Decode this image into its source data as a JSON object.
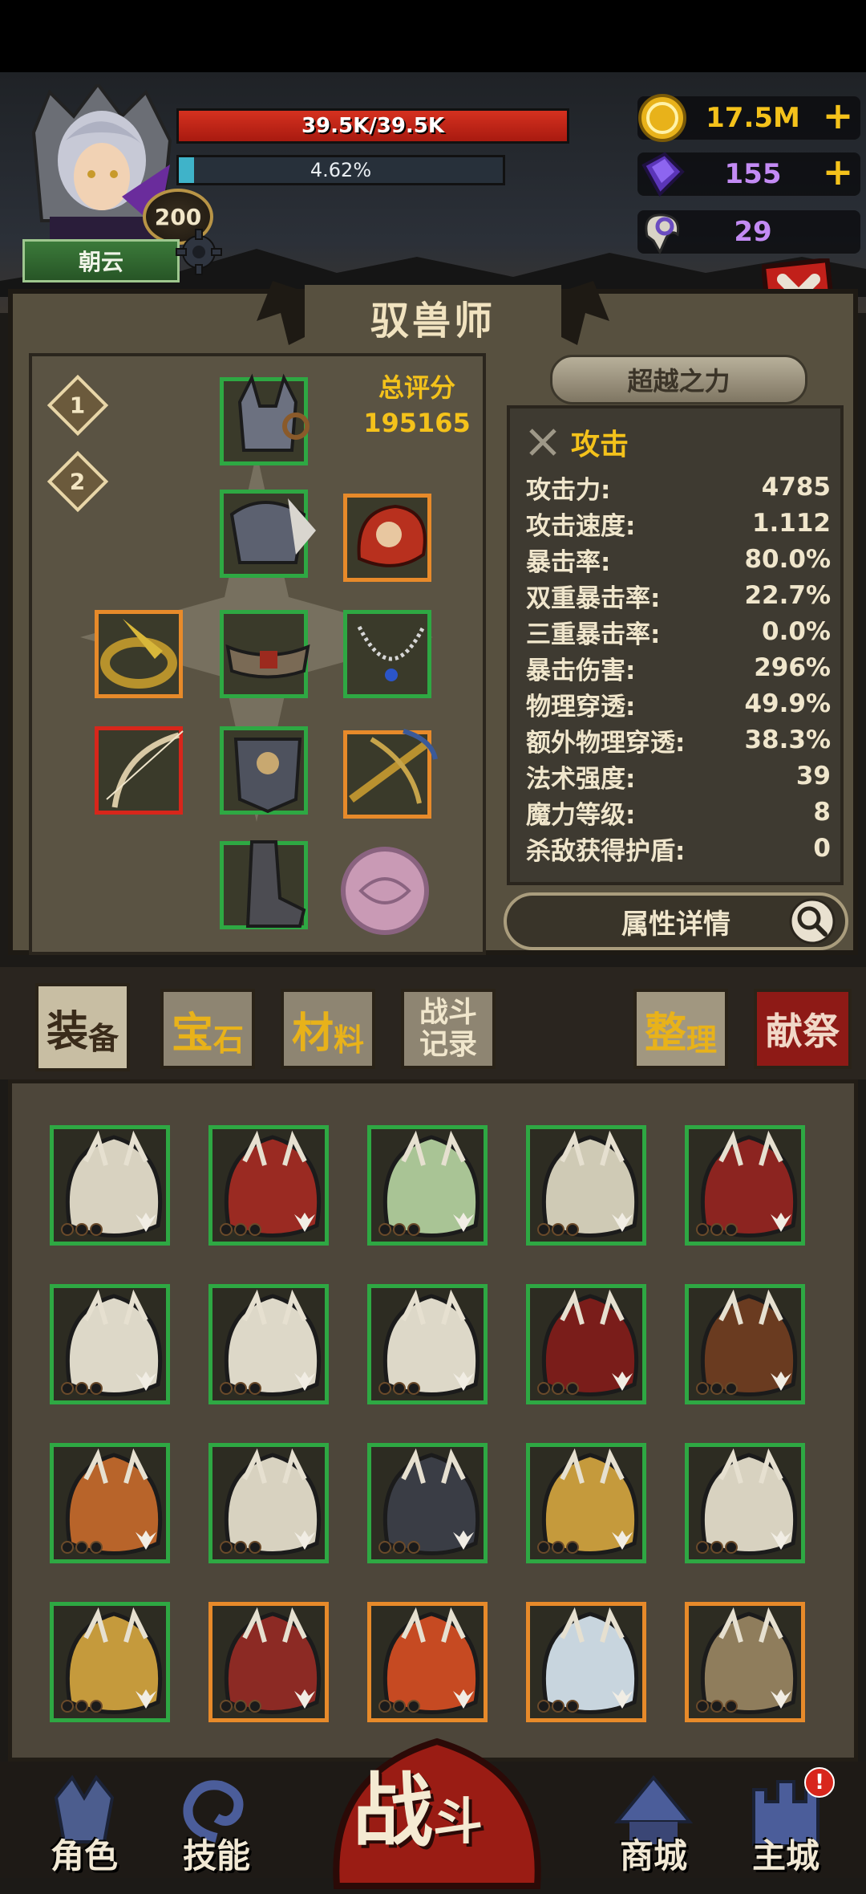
{
  "player": {
    "hp_text": "39.5K/39.5K",
    "hp_fraction": 1.0,
    "exp_text": "4.62%",
    "exp_fraction": 0.0462,
    "level": "200",
    "name": "朝云"
  },
  "currencies": {
    "gold": "17.5M",
    "gem": "155",
    "ram_horn": "29"
  },
  "panel": {
    "title": "驭兽师",
    "preset_1": "1",
    "preset_2": "2",
    "score_label": "总评分",
    "score_value": "195165",
    "beyond_button": "超越之力",
    "stats_heading": "攻击",
    "stats": [
      {
        "label": "攻击力:",
        "value": "4785"
      },
      {
        "label": "攻击速度:",
        "value": "1.112"
      },
      {
        "label": "暴击率:",
        "value": "80.0%"
      },
      {
        "label": "双重暴击率:",
        "value": "22.7%"
      },
      {
        "label": "三重暴击率:",
        "value": "0.0%"
      },
      {
        "label": "暴击伤害:",
        "value": "296%"
      },
      {
        "label": "物理穿透:",
        "value": "49.9%"
      },
      {
        "label": "额外物理穿透:",
        "value": "38.3%"
      },
      {
        "label": "法术强度:",
        "value": "39"
      },
      {
        "label": "魔力等级:",
        "value": "8"
      },
      {
        "label": "杀敌获得护盾:",
        "value": "0"
      }
    ],
    "detail_button": "属性详情"
  },
  "tabs": {
    "equip_1": "装",
    "equip_2": "备",
    "gem_1": "宝",
    "gem_2": "石",
    "material_1": "材",
    "material_2": "料",
    "record_1": "战斗",
    "record_2": "记录",
    "sort_1": "整",
    "sort_2": "理",
    "sacrifice": "献祭"
  },
  "nav": {
    "character": "角色",
    "skills": "技能",
    "battle_1": "战",
    "battle_2": "斗",
    "shop": "商城",
    "main_city": "主城",
    "notify_mark": "!"
  },
  "colors": {
    "rarity_green": "#2ea843",
    "rarity_orange": "#e78a2a",
    "rarity_red": "#d7261b",
    "gold_text": "#f4c21b",
    "hp_red": "#d5311f",
    "exp_cyan": "#3fb3c9"
  },
  "icons": {
    "gold": "gold-coin-icon",
    "gem": "purple-crystal-icon",
    "ram": "ram-skull-icon",
    "close": "close-x-icon",
    "settings": "gear-icon",
    "attack": "crossed-swords-icon",
    "search": "magnifier-icon"
  }
}
